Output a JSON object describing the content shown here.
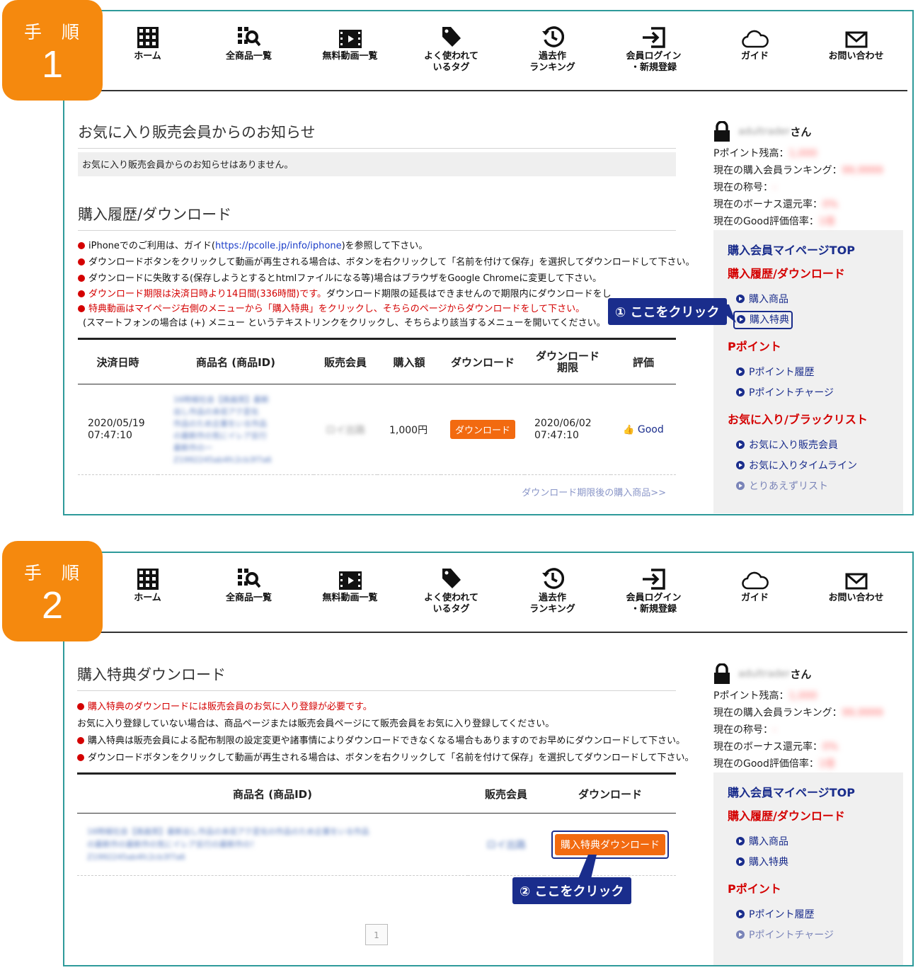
{
  "steps": [
    {
      "label": "手 順",
      "number": "1"
    },
    {
      "label": "手 順",
      "number": "2"
    }
  ],
  "nav": [
    {
      "icon": "grid-icon",
      "label_line1": "ホーム",
      "label_line2": ""
    },
    {
      "icon": "search-list-icon",
      "label_line1": "全商品一覧",
      "label_line2": ""
    },
    {
      "icon": "film-icon",
      "label_line1": "無料動画一覧",
      "label_line2": ""
    },
    {
      "icon": "tag-icon",
      "label_line1": "よく使われて",
      "label_line2": "いるタグ"
    },
    {
      "icon": "history-icon",
      "label_line1": "過去作",
      "label_line2": "ランキング"
    },
    {
      "icon": "login-icon",
      "label_line1": "会員ログイン",
      "label_line2": "・新規登録"
    },
    {
      "icon": "cloud-icon",
      "label_line1": "ガイド",
      "label_line2": ""
    },
    {
      "icon": "mail-icon",
      "label_line1": "お問い合わせ",
      "label_line2": ""
    }
  ],
  "panel1": {
    "notice_title": "お気に入り販売会員からのお知らせ",
    "notice_text": "お気に入り販売会員からのお知らせはありません。",
    "history_title": "購入履歴/ダウンロード",
    "bullet1_a": "iPhoneでのご利用は、ガイド(",
    "bullet1_link": "https://pcolle.jp/info/iphone",
    "bullet1_b": ")を参照して下さい。",
    "bullet2": "ダウンロードボタンをクリックして動画が再生される場合は、ボタンを右クリックして「名前を付けて保存」を選択してダウンロードして下さい。",
    "bullet3": "ダウンロードに失敗する(保存しようとするとhtmlファイルになる等)場合はブラウザをGoogle Chromeに変更して下さい。",
    "bullet4_red": "ダウンロード期限は決済日時より14日間(336時間)です。",
    "bullet4_black": "ダウンロード期限の延長はできませんので期限内にダウンロードをし",
    "bullet5": "特典動画はマイページ右側のメニューから「購入特典」をクリックし、そちらのページからダウンロードをして下さい。",
    "bullet5_note": "(スマートフォンの場合は (+) メニュー というテキストリンクをクリックし、そちらより該当するメニューを開いてください。",
    "table_headers": [
      "決済日時",
      "商品名 (商品ID)",
      "販売会員",
      "購入額",
      "ダウンロード",
      "ダウンロード",
      "期限",
      "評価"
    ],
    "row": {
      "date": "2020/05/19",
      "time": "07:47:10",
      "product_blur": "16時候社会【高画質】最新\n出し作品の未収アク変化\n作品のため企業をいる作品\nの最新作の気にイレア反行\n最新作の一\nZ1992245ab4fc2cb3f7a6",
      "seller_blur": "ロイ出路",
      "price": "1,000円",
      "download_label": "ダウンロード",
      "expiry_date": "2020/06/02",
      "expiry_time": "07:47:10",
      "rating": "Good"
    },
    "expired_link": "ダウンロード期限後の購入商品>>",
    "callout": "① ここをクリック"
  },
  "panel2": {
    "title": "購入特典ダウンロード",
    "bullet1_red": "購入特典のダウンロードには販売会員のお気に入り登録が必要です。",
    "bullet1_note": "お気に入り登録していない場合は、商品ページまたは販売会員ページにて販売会員をお気に入り登録してください。",
    "bullet2": "購入特典は販売会員による配布制限の設定変更や諸事情によりダウンロードできなくなる場合もありますのでお早めにダウンロードして下さい。",
    "bullet3": "ダウンロードボタンをクリックして動画が再生される場合は、ボタンを右クリックして「名前を付けて保存」を選択してダウンロードして下さい。",
    "table_headers": [
      "商品名 (商品ID)",
      "販売会員",
      "ダウンロード"
    ],
    "product_blur": "16時候社会【高画質】最新出し作品の未収アク変化の作品のため企業をいる作品\nの最新作の最新作の気にイレア反行の最新作の！\nZ1992245ab4fc2cb3f7a6",
    "seller_blur": "ロイ出路",
    "download_label": "購入特典ダウンロード",
    "callout": "② ここをクリック",
    "page_number": "1"
  },
  "sidebar": {
    "username_blur": "adultrader",
    "san": "さん",
    "points_label": "Pポイント残高：",
    "points_blur": "1,000",
    "rank_label": "現在の購入会員ランキング：",
    "rank_blur": "99,9999",
    "title_label": "現在の称号：",
    "title_blur": "-",
    "bonus_label": "現在のボーナス還元率：",
    "bonus_blur": "0%",
    "good_label": "現在のGood評価倍率：",
    "good_blur": "1倍",
    "menu_top": "購入会員マイページTOP",
    "menu_history": "購入履歴/ダウンロード",
    "menu_purchased": "購入商品",
    "menu_bonus": "購入特典",
    "menu_points": "Pポイント",
    "menu_points_history": "Pポイント履歴",
    "menu_points_charge": "Pポイントチャージ",
    "menu_fav": "お気に入り/ブラックリスト",
    "menu_fav_sellers": "お気に入り販売会員",
    "menu_fav_timeline": "お気に入りタイムライン",
    "menu_tentative": "とりあえずリスト"
  },
  "colors": {
    "frame": "#2e9a9a",
    "badge": "#f5890e",
    "accent_red": "#d40000",
    "navy": "#1a2d8c",
    "download_button": "#f26a10"
  }
}
